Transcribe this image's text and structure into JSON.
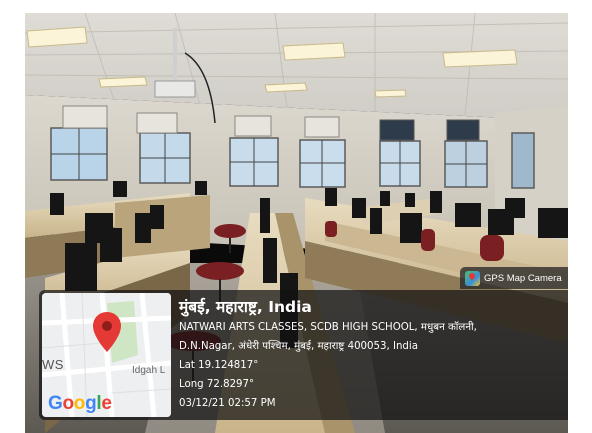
{
  "photo": {
    "subject": "computer lab classroom photo"
  },
  "gps_overlay": {
    "badge_label": "GPS Map Camera",
    "badge_icon": "gps-map-camera-icon",
    "place_title": "मुंबई, महाराष्ट्र, India",
    "address_line1": "NATWARI ARTS CLASSES, SCDB HIGH SCHOOL, मधुबन कॉलनी,",
    "address_line2": "D.N.Nagar, अंधेरी पश्चिम, मुंबई, महाराष्ट्र 400053, India",
    "latitude": "Lat 19.124817°",
    "longitude": "Long 72.8297°",
    "datetime": "03/12/21 02:57 PM"
  },
  "map_thumbnail": {
    "left_label": "WS",
    "road_label": "Idgah L",
    "provider_logo": [
      "G",
      "o",
      "o",
      "g",
      "l",
      "e"
    ],
    "pin_color": "#e53935"
  }
}
